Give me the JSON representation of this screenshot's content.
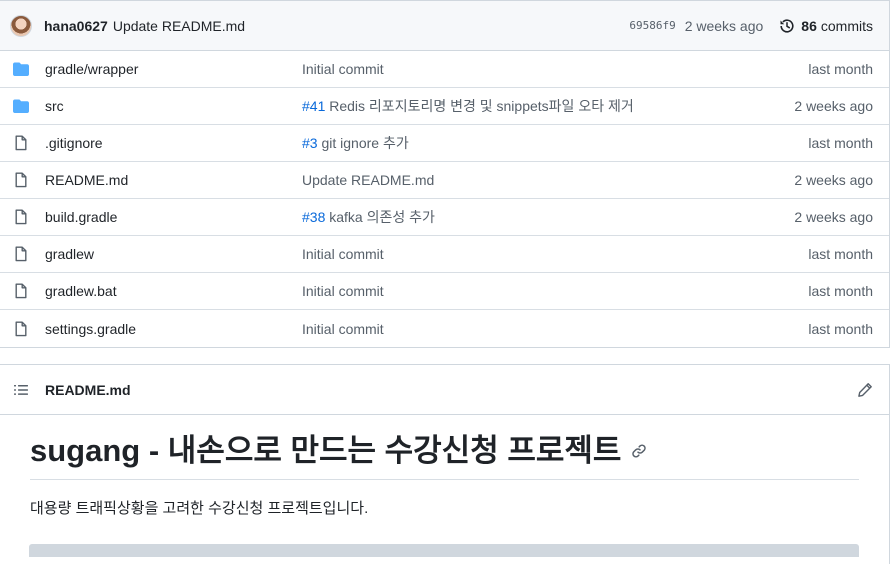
{
  "commit": {
    "author": "hana0627",
    "message": "Update README.md",
    "sha": "69586f9",
    "when": "2 weeks ago",
    "commits_count": "86",
    "commits_label": "commits"
  },
  "files": [
    {
      "type": "folder",
      "name": "gradle/wrapper",
      "issue": "",
      "message": "Initial commit",
      "age": "last month"
    },
    {
      "type": "folder",
      "name": "src",
      "issue": "#41",
      "message": " Redis 리포지토리명 변경 및 snippets파일 오타 제거",
      "age": "2 weeks ago"
    },
    {
      "type": "file",
      "name": ".gitignore",
      "issue": "#3",
      "message": " git ignore 추가",
      "age": "last month"
    },
    {
      "type": "file",
      "name": "README.md",
      "issue": "",
      "message": "Update README.md",
      "age": "2 weeks ago"
    },
    {
      "type": "file",
      "name": "build.gradle",
      "issue": "#38",
      "message": " kafka 의존성 추가",
      "age": "2 weeks ago"
    },
    {
      "type": "file",
      "name": "gradlew",
      "issue": "",
      "message": "Initial commit",
      "age": "last month"
    },
    {
      "type": "file",
      "name": "gradlew.bat",
      "issue": "",
      "message": "Initial commit",
      "age": "last month"
    },
    {
      "type": "file",
      "name": "settings.gradle",
      "issue": "",
      "message": "Initial commit",
      "age": "last month"
    }
  ],
  "readme": {
    "filename": "README.md",
    "heading": "sugang - 내손으로 만드는 수강신청 프로젝트",
    "paragraph": "대용량 트래픽상황을 고려한 수강신청 프로젝트입니다."
  },
  "colors": {
    "folder": "#54aeff",
    "link": "#0969da",
    "muted": "#57606a"
  }
}
